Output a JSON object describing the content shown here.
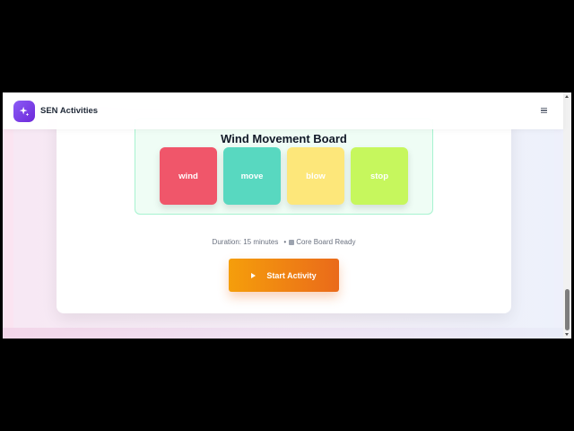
{
  "header": {
    "brand": "SEN Activities",
    "logo_icon": "sparkle-icon",
    "menu_icon": "hamburger-menu-icon"
  },
  "board": {
    "title": "Wind Movement Board",
    "tiles": [
      {
        "label": "wind",
        "color": "#f0566a"
      },
      {
        "label": "move",
        "color": "#58d8c0"
      },
      {
        "label": "blow",
        "color": "#fde77a"
      },
      {
        "label": "stop",
        "color": "#c6f75d"
      }
    ]
  },
  "meta": {
    "duration": "Duration: 15 minutes",
    "separator": "•",
    "status": "Core Board Ready",
    "status_icon": "board-icon"
  },
  "actions": {
    "start_label": "Start Activity",
    "start_icon": "play-icon"
  },
  "colors": {
    "accent": "#7c3aed",
    "button_start": "#f59e0b",
    "button_end": "#ea6a1a",
    "board_border": "#a7f3d0"
  }
}
